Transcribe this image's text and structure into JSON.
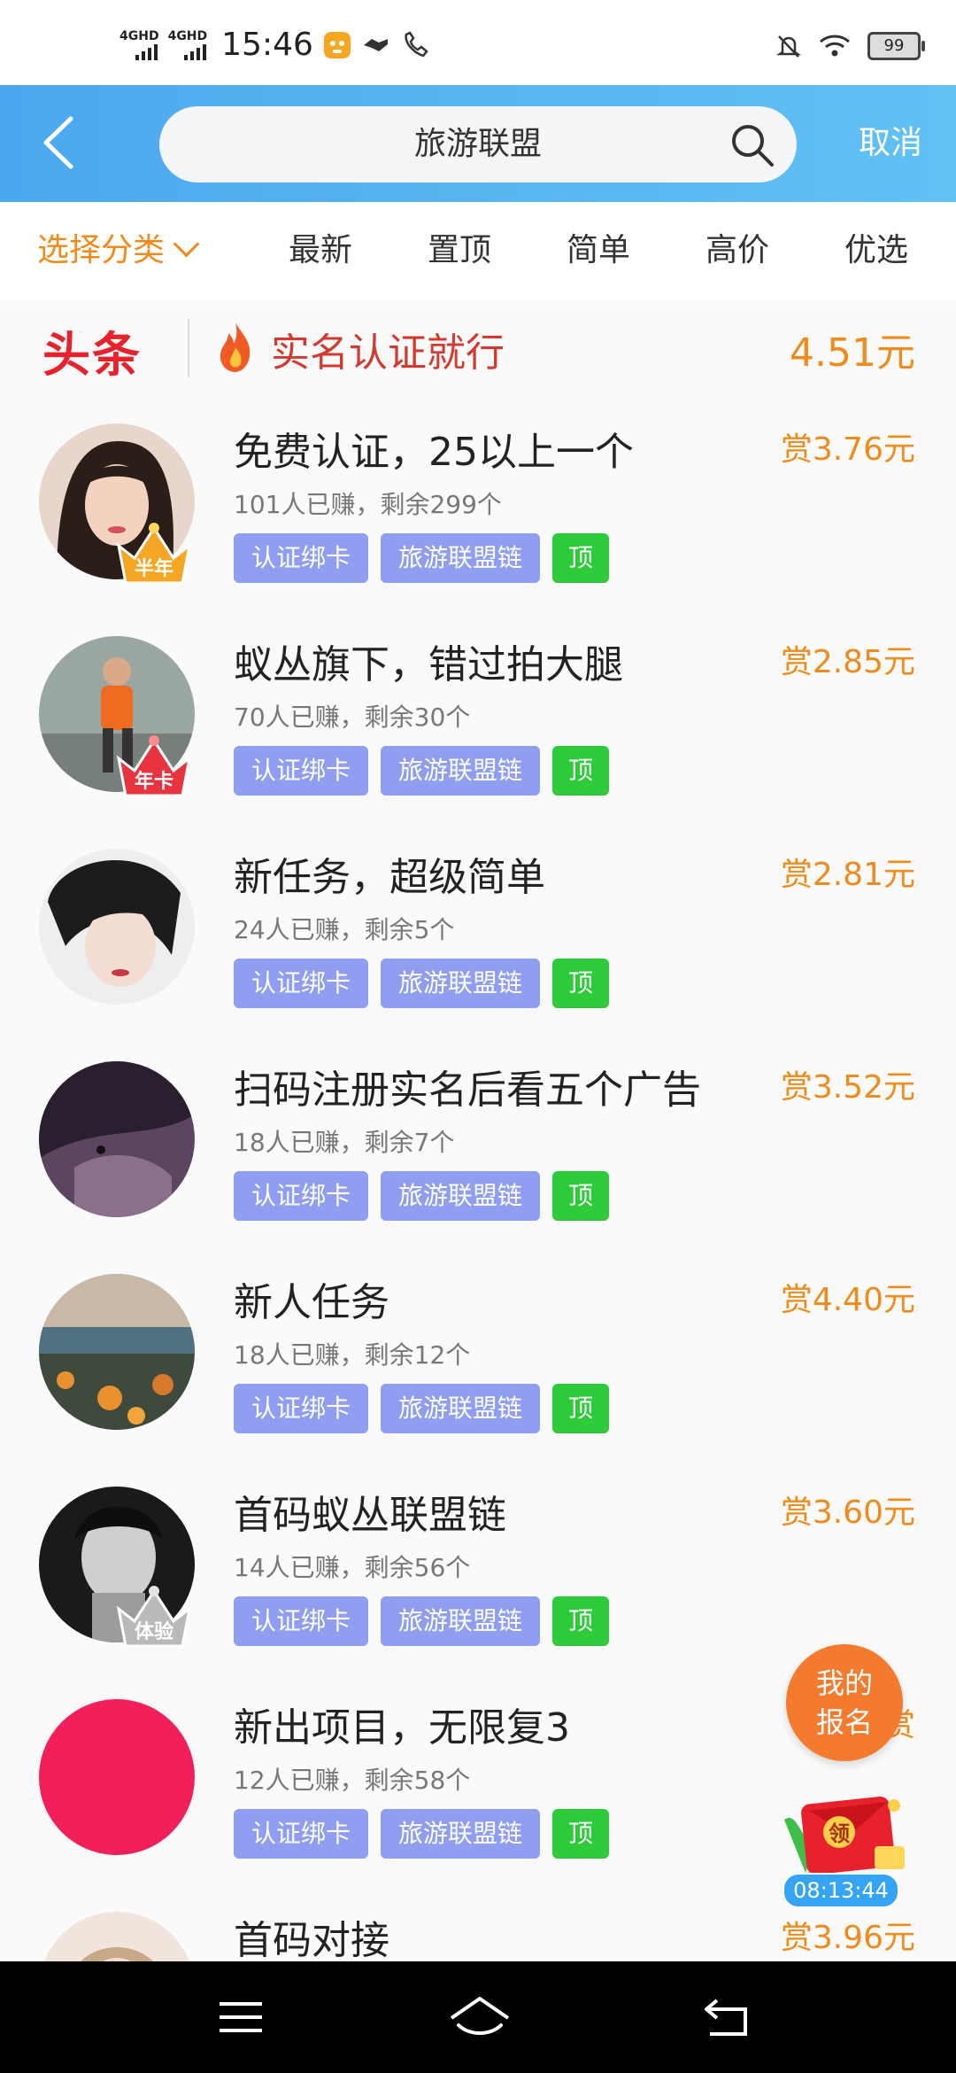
{
  "status": {
    "sim1": "4GHD",
    "sim2": "4GHD",
    "time": "15:46",
    "battery": "99",
    "icons": [
      "tiger-app-icon",
      "handshake-icon",
      "phone-icon",
      "mute-bell-icon",
      "wifi-icon",
      "battery-icon"
    ]
  },
  "header": {
    "search_text": "旅游联盟",
    "cancel": "取消"
  },
  "tabs": [
    "选择分类",
    "最新",
    "置顶",
    "简单",
    "高价",
    "优选"
  ],
  "headline": {
    "logo": "头条",
    "text": "实名认证就行",
    "price": "4.51元"
  },
  "items": [
    {
      "title": "免费认证，25以上一个",
      "reward": "赏3.76元",
      "meta": "101人已赚，剩余299个",
      "badge": "半年",
      "tags": [
        "认证绑卡",
        "旅游联盟链",
        "顶"
      ]
    },
    {
      "title": "蚁丛旗下，错过拍大腿",
      "reward": "赏2.85元",
      "meta": "70人已赚，剩余30个",
      "badge": "年卡",
      "tags": [
        "认证绑卡",
        "旅游联盟链",
        "顶"
      ]
    },
    {
      "title": "新任务，超级简单",
      "reward": "赏2.81元",
      "meta": "24人已赚，剩余5个",
      "badge": "",
      "tags": [
        "认证绑卡",
        "旅游联盟链",
        "顶"
      ]
    },
    {
      "title": "扫码注册实名后看五个广告",
      "reward": "赏3.52元",
      "meta": "18人已赚，剩余7个",
      "badge": "",
      "tags": [
        "认证绑卡",
        "旅游联盟链",
        "顶"
      ]
    },
    {
      "title": "新人任务",
      "reward": "赏4.40元",
      "meta": "18人已赚，剩余12个",
      "badge": "",
      "tags": [
        "认证绑卡",
        "旅游联盟链",
        "顶"
      ]
    },
    {
      "title": "首码蚁丛联盟链",
      "reward": "赏3.60元",
      "meta": "14人已赚，剩余56个",
      "badge": "体验",
      "tags": [
        "认证绑卡",
        "旅游联盟链",
        "顶"
      ]
    },
    {
      "title": "新出项目，无限复3",
      "reward": "赏",
      "meta": "12人已赚，剩余58个",
      "badge": "",
      "tags": [
        "认证绑卡",
        "旅游联盟链",
        "顶"
      ]
    },
    {
      "title": "首码对接",
      "reward": "赏3.96元",
      "meta": "",
      "badge": "",
      "tags": []
    }
  ],
  "floating": {
    "fab_line1": "我的",
    "fab_line2": "报名",
    "redpack_label": "领",
    "timer": "08:13:44"
  },
  "colors": {
    "accent_orange": "#f08a1a",
    "header_blue": "#4ca8ee",
    "tag_purple": "#8f9ef0",
    "tag_green": "#2dcb3a",
    "headline_red": "#e8222c"
  }
}
